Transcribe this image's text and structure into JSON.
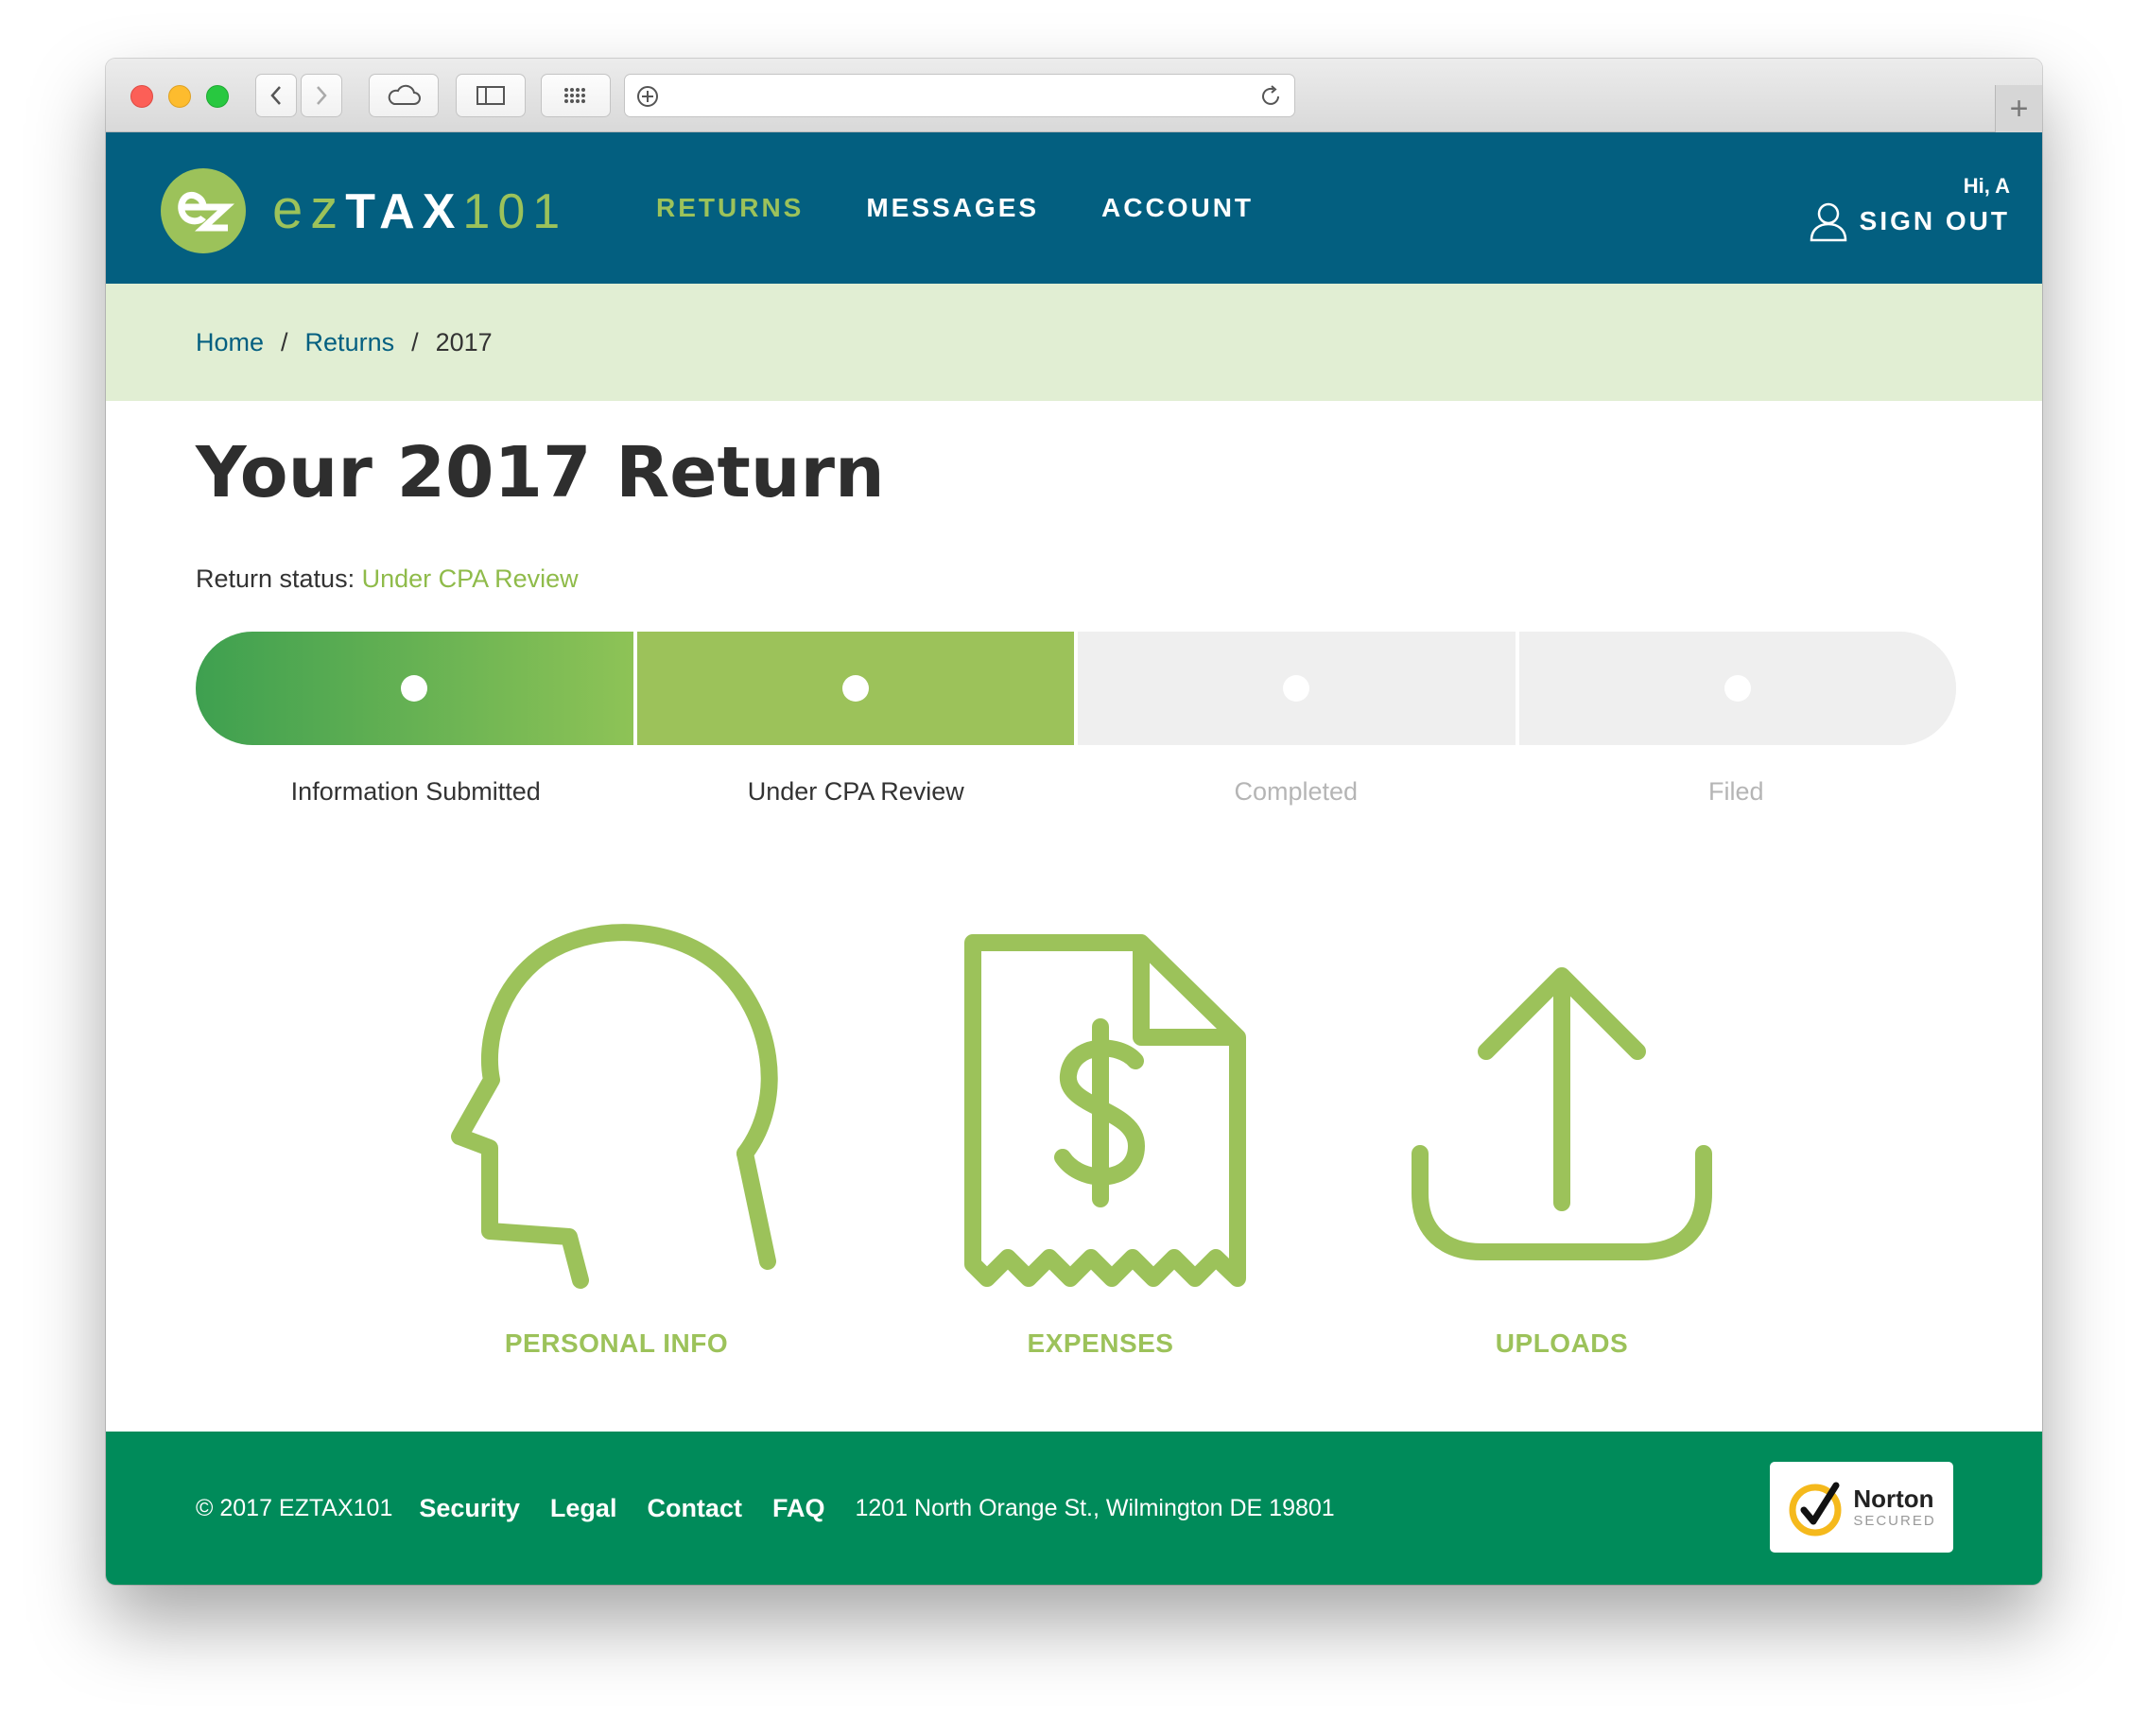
{
  "browser": {
    "new_tab_symbol": "+"
  },
  "header": {
    "logo_ez": "ez",
    "logo_tax": "TAX",
    "logo_num": "101",
    "nav": [
      {
        "label": "RETURNS",
        "active": true
      },
      {
        "label": "MESSAGES",
        "active": false
      },
      {
        "label": "ACCOUNT",
        "active": false
      }
    ],
    "greeting": "Hi, A",
    "sign_out": "SIGN OUT"
  },
  "breadcrumb": {
    "home": "Home",
    "returns": "Returns",
    "separator": "/",
    "current": "2017"
  },
  "main": {
    "title": "Your 2017 Return",
    "status_label": "Return status:",
    "status_value": "Under CPA Review",
    "steps": [
      {
        "label": "Information Submitted",
        "state": "done"
      },
      {
        "label": "Under CPA Review",
        "state": "current"
      },
      {
        "label": "Completed",
        "state": "todo"
      },
      {
        "label": "Filed",
        "state": "todo"
      }
    ],
    "tiles": [
      {
        "label": "PERSONAL INFO",
        "icon": "head-profile-icon"
      },
      {
        "label": "EXPENSES",
        "icon": "receipt-dollar-icon"
      },
      {
        "label": "UPLOADS",
        "icon": "upload-icon"
      }
    ]
  },
  "footer": {
    "copyright": "© 2017 EZTAX101",
    "links": [
      "Security",
      "Legal",
      "Contact",
      "FAQ"
    ],
    "address": "1201 North Orange St., Wilmington DE 19801",
    "norton_title": "Norton",
    "norton_sub": "SECURED"
  },
  "colors": {
    "header_bg": "#035f80",
    "accent_green": "#9cc25a",
    "footer_green": "#008b5a",
    "breadcrumb_bg": "#e1eed3"
  }
}
